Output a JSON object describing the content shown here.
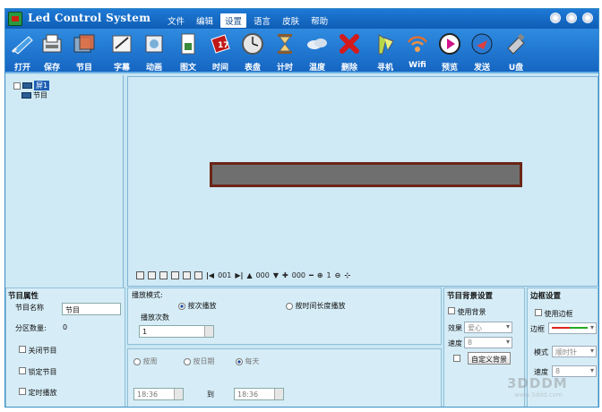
{
  "app": {
    "title": "Led Control System"
  },
  "menu": [
    {
      "label": "文件"
    },
    {
      "label": "编辑"
    },
    {
      "label": "设置",
      "active": true
    },
    {
      "label": "语言"
    },
    {
      "label": "皮肤"
    },
    {
      "label": "帮助"
    }
  ],
  "toolbar": [
    {
      "label": "打开",
      "icon": "open-icon"
    },
    {
      "label": "保存",
      "icon": "save-icon"
    },
    {
      "label": "节目",
      "icon": "program-icon"
    },
    {
      "label": "字幕",
      "icon": "subtitle-icon"
    },
    {
      "label": "动画",
      "icon": "animation-icon"
    },
    {
      "label": "图文",
      "icon": "image-text-icon"
    },
    {
      "label": "时间",
      "icon": "clock-icon"
    },
    {
      "label": "表盘",
      "icon": "dial-icon"
    },
    {
      "label": "计时",
      "icon": "hourglass-icon"
    },
    {
      "label": "温度",
      "icon": "temperature-icon"
    },
    {
      "label": "删除",
      "icon": "delete-icon"
    },
    {
      "label": "寻机",
      "icon": "search-device-icon"
    },
    {
      "label": "Wifi",
      "icon": "wifi-icon"
    },
    {
      "label": "预览",
      "icon": "preview-icon"
    },
    {
      "label": "发送",
      "icon": "send-icon"
    },
    {
      "label": "U盘",
      "icon": "usb-icon"
    }
  ],
  "tree": {
    "screen": "屏1",
    "program": "节目"
  },
  "zoom": {
    "v1": "001",
    "v2": "000",
    "v3": "000",
    "v4": "1"
  },
  "program_props": {
    "title": "节目属性",
    "name_label": "节目名称",
    "name_value": "节目",
    "partitions_label": "分区数量:",
    "partitions_value": "0",
    "close_label": "关闭节目",
    "lock_label": "锁定节目",
    "timed_label": "定时播放"
  },
  "play_mode": {
    "title": "播放模式:",
    "by_count": "按次播放",
    "by_duration": "按时间长度播放",
    "count_label": "播放次数",
    "count_value": "1",
    "weekly": "按周",
    "by_date": "按日期",
    "daily": "每天",
    "time_from": "18:36",
    "to_label": "到",
    "time_to": "18:36"
  },
  "bg": {
    "title": "节目背景设置",
    "use_label": "使用背景",
    "effect_label": "效果",
    "effect_value": "爱心",
    "speed_label": "速度",
    "speed_value": "8",
    "custom_btn": "自定义背景"
  },
  "border": {
    "title": "边框设置",
    "use_label": "使用边框",
    "border_label": "边框",
    "mode_label": "模式",
    "mode_value": "顺时针",
    "speed_label": "速度",
    "speed_value": "8"
  },
  "watermark": {
    "main": "3DDDM",
    "sub": "www.3ddd.com"
  }
}
